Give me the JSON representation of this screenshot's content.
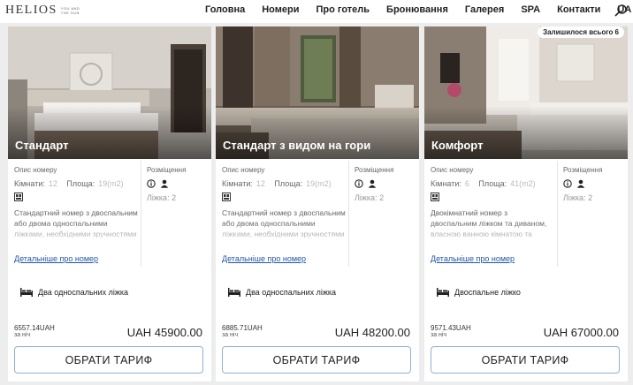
{
  "header": {
    "logo": "HELIOS",
    "logo_sub": "YOU AND THE SUN",
    "nav": [
      "Головна",
      "Номери",
      "Про готель",
      "Бронювання",
      "Галерея",
      "SPA",
      "Контакти"
    ],
    "lang": "UA"
  },
  "cards": [
    {
      "title": "Стандарт",
      "badge": "",
      "desc_label": "Опис номеру",
      "rooms_label": "Кімнати:",
      "rooms": "12",
      "area_label": "Площа:",
      "area": "19(m2)",
      "description": "Стандартний номер з двоспальним або двома односпальними ліжками, необхідними зручностями та",
      "more": "Детальніше про номер",
      "placement_label": "Розміщення",
      "beds_caption": "Ліжка: 2",
      "bed_type": "Два односпальних ліжка",
      "price_old": "6557.14UAH",
      "per_night": "за ніч",
      "price": "UAH 45900.00",
      "cta": "ОБРАТИ ТАРИФ"
    },
    {
      "title": "Стандарт з видом на гори",
      "badge": "",
      "desc_label": "Опис номеру",
      "rooms_label": "Кімнати:",
      "rooms": "12",
      "area_label": "Площа:",
      "area": "19(m2)",
      "description": "Стандартний номер з двоспальним або двома односпальними ліжками, необхідними зручностями та",
      "more": "Детальніше про номер",
      "placement_label": "Розміщення",
      "beds_caption": "Ліжка: 2",
      "bed_type": "Два односпальних ліжка",
      "price_old": "6885.71UAH",
      "per_night": "за ніч",
      "price": "UAH 48200.00",
      "cta": "ОБРАТИ ТАРИФ"
    },
    {
      "title": "Комфорт",
      "badge": "Залишилося всього 6",
      "desc_label": "Опис номеру",
      "rooms_label": "Кімнати:",
      "rooms": "6",
      "area_label": "Площа:",
      "area": "41(m2)",
      "description": "Двокімнатний номер з двоспальним ліжком та диваном, власною ванною кімнатою та",
      "more": "Детальніше про номер",
      "placement_label": "Розміщення",
      "beds_caption": "Ліжка: 2",
      "bed_type": "Двоспальне ліжко",
      "price_old": "9571.43UAH",
      "per_night": "за ніч",
      "price": "UAH 67000.00",
      "cta": "ОБРАТИ ТАРИФ"
    }
  ],
  "icons": {
    "search": "search-icon",
    "info": "info-icon",
    "person": "person-icon",
    "door": "door-icon",
    "bed": "bed-icon"
  },
  "colors": {
    "link": "#2255aa",
    "button_border": "#8fb1d6"
  }
}
